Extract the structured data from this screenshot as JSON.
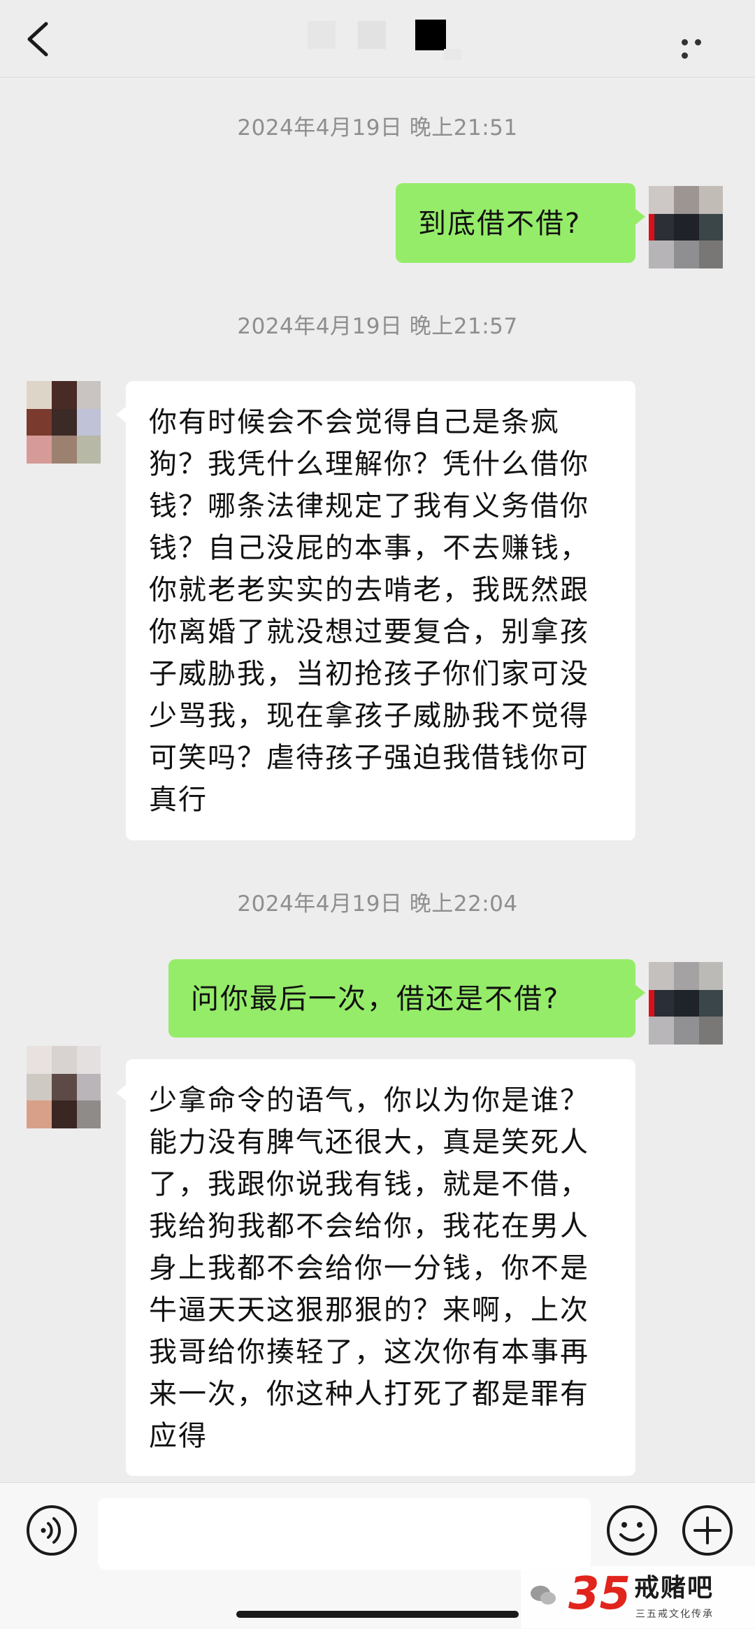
{
  "header": {
    "back_icon": "chevron-left-icon",
    "title_note": "",
    "more_icon": "more-dots-icon"
  },
  "messages": [
    {
      "type": "timestamp",
      "text": "2024年4月19日 晚上21:51"
    },
    {
      "type": "outgoing",
      "text": "到底借不借?"
    },
    {
      "type": "timestamp",
      "text": "2024年4月19日 晚上21:57"
    },
    {
      "type": "incoming",
      "text": "你有时候会不会觉得自己是条疯狗？我凭什么理解你？凭什么借你钱？哪条法律规定了我有义务借你钱？自己没屁的本事，不去赚钱，你就老老实实的去啃老，我既然跟你离婚了就没想过要复合，别拿孩子威胁我，当初抢孩子你们家可没少骂我，现在拿孩子威胁我不觉得可笑吗？虐待孩子强迫我借钱你可真行"
    },
    {
      "type": "timestamp",
      "text": "2024年4月19日 晚上22:04"
    },
    {
      "type": "outgoing",
      "text": "问你最后一次，借还是不借?"
    },
    {
      "type": "incoming",
      "text": "少拿命令的语气，你以为你是谁？能力没有脾气还很大，真是笑死人了，我跟你说我有钱，就是不借，我给狗我都不会给你，我花在男人身上我都不会给你一分钱，你不是牛逼天天这狠那狠的？来啊，上次我哥给你揍轻了，这次你有本事再来一次，你这种人打死了都是罪有应得"
    }
  ],
  "input_bar": {
    "voice_icon": "voice-icon",
    "text_value": "",
    "emoji_icon": "emoji-icon",
    "plus_icon": "plus-icon"
  },
  "watermark": {
    "number": "35",
    "title": "戒赌吧",
    "subtitle": "三五戒文化传承",
    "chat_icon": "wechat-icon"
  },
  "colors": {
    "background": "#ededed",
    "outgoing_bubble": "#95ec69",
    "incoming_bubble": "#ffffff",
    "timestamp_text": "#8e8e8e",
    "watermark_red": "#e1241c"
  }
}
